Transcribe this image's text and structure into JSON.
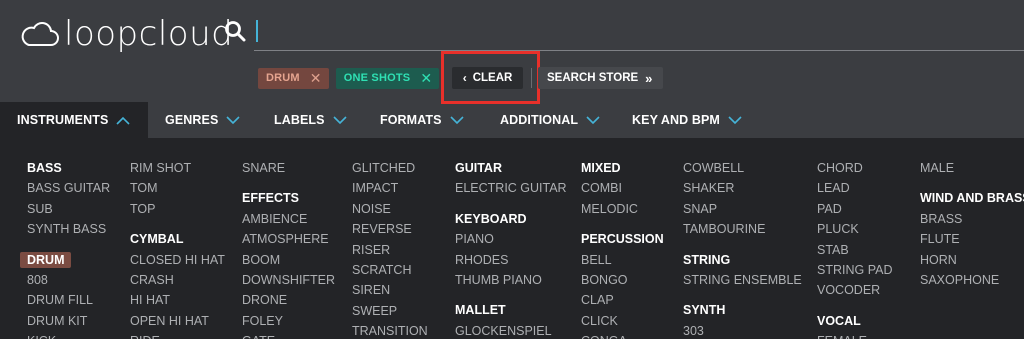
{
  "app": {
    "logo_text": "loopcloud",
    "logo_icon": "cloud-icon",
    "search_icon": "search-icon",
    "colors": {
      "accent": "#45b4d8",
      "highlight": "#e8302a",
      "drum_chip": "#74473f",
      "oneshots_chip": "#1d5c4f"
    }
  },
  "filters": {
    "chips": [
      {
        "label": "DRUM",
        "remove": "✕"
      },
      {
        "label": "ONE SHOTS",
        "remove": "✕"
      }
    ],
    "clear_label": "CLEAR",
    "clear_chevron": "‹",
    "store_label": "SEARCH STORE",
    "store_chevron": "»"
  },
  "tabs": [
    {
      "label": "INSTRUMENTS",
      "active": true
    },
    {
      "label": "GENRES"
    },
    {
      "label": "LABELS"
    },
    {
      "label": "FORMATS"
    },
    {
      "label": "ADDITIONAL"
    },
    {
      "label": "KEY AND BPM"
    }
  ],
  "columns": [
    [
      {
        "t": "BASS",
        "h": true
      },
      {
        "t": "BASS GUITAR"
      },
      {
        "t": "SUB"
      },
      {
        "t": "SYNTH BASS"
      },
      {
        "gap": true
      },
      {
        "t": "DRUM",
        "sel": true
      },
      {
        "t": "808"
      },
      {
        "t": "DRUM FILL"
      },
      {
        "t": "DRUM KIT"
      },
      {
        "t": "KICK"
      }
    ],
    [
      {
        "t": "RIM SHOT"
      },
      {
        "t": "TOM"
      },
      {
        "t": "TOP"
      },
      {
        "gap": true
      },
      {
        "t": "CYMBAL",
        "h": true
      },
      {
        "t": "CLOSED HI HAT"
      },
      {
        "t": "CRASH"
      },
      {
        "t": "HI HAT"
      },
      {
        "t": "OPEN HI HAT"
      },
      {
        "t": "RIDE"
      }
    ],
    [
      {
        "t": "SNARE"
      },
      {
        "gap": true
      },
      {
        "t": "EFFECTS",
        "h": true
      },
      {
        "t": "AMBIENCE"
      },
      {
        "t": "ATMOSPHERE"
      },
      {
        "t": "BOOM"
      },
      {
        "t": "DOWNSHIFTER"
      },
      {
        "t": "DRONE"
      },
      {
        "t": "FOLEY"
      },
      {
        "t": "GATE"
      }
    ],
    [
      {
        "t": "GLITCHED"
      },
      {
        "t": "IMPACT"
      },
      {
        "t": "NOISE"
      },
      {
        "t": "REVERSE"
      },
      {
        "t": "RISER"
      },
      {
        "t": "SCRATCH"
      },
      {
        "t": "SIREN"
      },
      {
        "t": "SWEEP"
      },
      {
        "t": "TRANSITION"
      }
    ],
    [
      {
        "t": "GUITAR",
        "h": true
      },
      {
        "t": "ELECTRIC GUITAR"
      },
      {
        "gap": true
      },
      {
        "t": "KEYBOARD",
        "h": true
      },
      {
        "t": "PIANO"
      },
      {
        "t": "RHODES"
      },
      {
        "t": "THUMB PIANO"
      },
      {
        "gap": true
      },
      {
        "t": "MALLET",
        "h": true
      },
      {
        "t": "GLOCKENSPIEL"
      }
    ],
    [
      {
        "t": "MIXED",
        "h": true
      },
      {
        "t": "COMBI"
      },
      {
        "t": "MELODIC"
      },
      {
        "gap": true
      },
      {
        "t": "PERCUSSION",
        "h": true
      },
      {
        "t": "BELL"
      },
      {
        "t": "BONGO"
      },
      {
        "t": "CLAP"
      },
      {
        "t": "CLICK"
      },
      {
        "t": "CONGA"
      }
    ],
    [
      {
        "t": "COWBELL"
      },
      {
        "t": "SHAKER"
      },
      {
        "t": "SNAP"
      },
      {
        "t": "TAMBOURINE"
      },
      {
        "gap": true
      },
      {
        "t": "STRING",
        "h": true
      },
      {
        "t": "STRING ENSEMBLE"
      },
      {
        "gap": true
      },
      {
        "t": "SYNTH",
        "h": true
      },
      {
        "t": "303"
      }
    ],
    [
      {
        "t": "CHORD"
      },
      {
        "t": "LEAD"
      },
      {
        "t": "PAD"
      },
      {
        "t": "PLUCK"
      },
      {
        "t": "STAB"
      },
      {
        "t": "STRING PAD"
      },
      {
        "t": "VOCODER"
      },
      {
        "gap": true
      },
      {
        "t": "VOCAL",
        "h": true
      },
      {
        "t": "FEMALE"
      }
    ],
    [
      {
        "t": "MALE"
      },
      {
        "gap": true
      },
      {
        "t": "WIND AND BRASS",
        "h": true
      },
      {
        "t": "BRASS"
      },
      {
        "t": "FLUTE"
      },
      {
        "t": "HORN"
      },
      {
        "t": "SAXOPHONE"
      }
    ]
  ]
}
